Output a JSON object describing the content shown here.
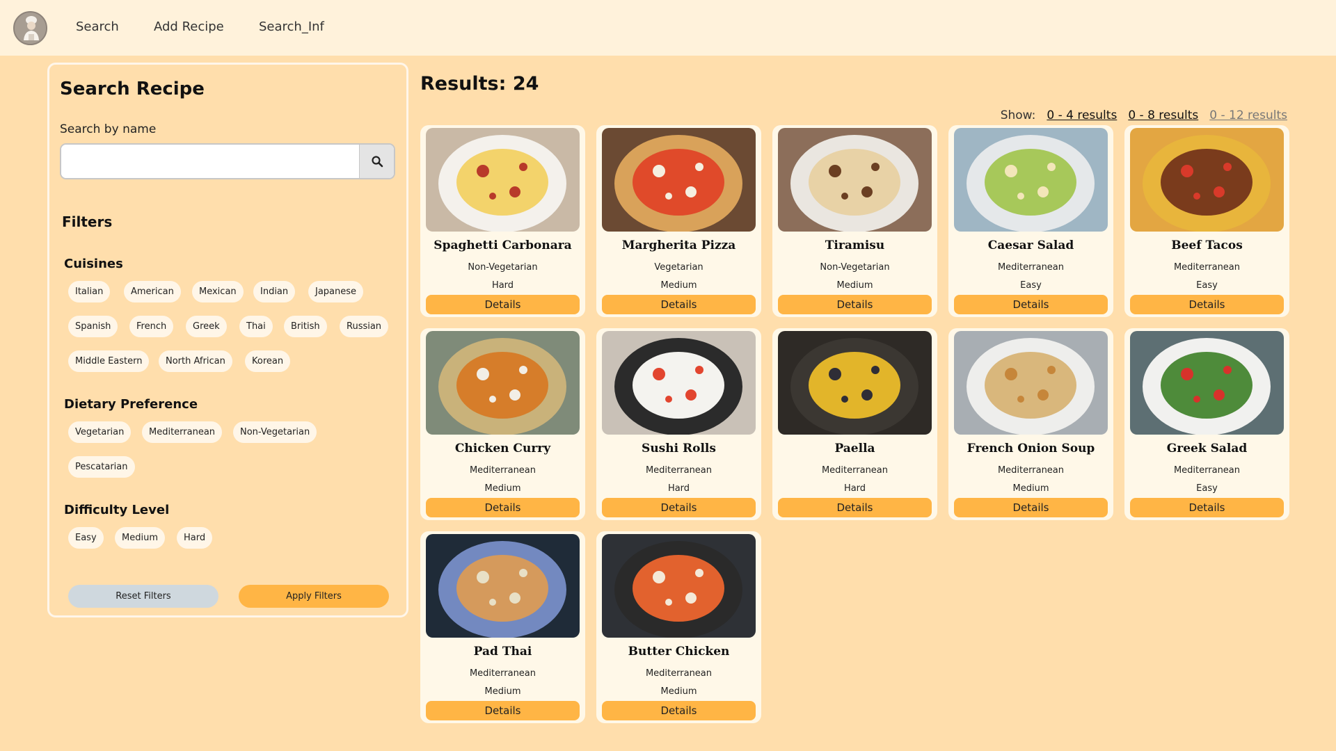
{
  "nav": {
    "logo_alt": "chef logo",
    "links": [
      "Search",
      "Add Recipe",
      "Search_Inf"
    ]
  },
  "sidebar": {
    "title": "Search Recipe",
    "search_label": "Search by name",
    "search_value": "",
    "filters_title": "Filters",
    "cuisines_title": "Cuisines",
    "cuisines": [
      "Italian",
      "American",
      "Mexican",
      "Indian",
      "Japanese",
      "Spanish",
      "French",
      "Greek",
      "Thai",
      "British",
      "Russian",
      "Middle Eastern",
      "North African",
      "Korean"
    ],
    "dietary_title": "Dietary Preference",
    "dietary": [
      "Vegetarian",
      "Mediterranean",
      "Non-Vegetarian",
      "Pescatarian"
    ],
    "difficulty_title": "Difficulty Level",
    "difficulty": [
      "Easy",
      "Medium",
      "Hard"
    ],
    "reset_label": "Reset Filters",
    "apply_label": "Apply Filters"
  },
  "results": {
    "title": "Results: 24",
    "show_label": "Show:",
    "show_options": [
      "0 - 4 results",
      "0 - 8 results",
      "0 - 12 results"
    ],
    "details_label": "Details",
    "recipes": [
      {
        "name": "Spaghetti Carbonara",
        "diet": "Non-Vegetarian",
        "difficulty": "Hard",
        "icon": "pasta-image"
      },
      {
        "name": "Margherita Pizza",
        "diet": "Vegetarian",
        "difficulty": "Medium",
        "icon": "pizza-image"
      },
      {
        "name": "Tiramisu",
        "diet": "Non-Vegetarian",
        "difficulty": "Medium",
        "icon": "tiramisu-image"
      },
      {
        "name": "Caesar Salad",
        "diet": "Mediterranean",
        "difficulty": "Easy",
        "icon": "salad-image"
      },
      {
        "name": "Beef Tacos",
        "diet": "Mediterranean",
        "difficulty": "Easy",
        "icon": "tacos-image"
      },
      {
        "name": "Chicken Curry",
        "diet": "Mediterranean",
        "difficulty": "Medium",
        "icon": "curry-image"
      },
      {
        "name": "Sushi Rolls",
        "diet": "Mediterranean",
        "difficulty": "Hard",
        "icon": "sushi-image"
      },
      {
        "name": "Paella",
        "diet": "Mediterranean",
        "difficulty": "Hard",
        "icon": "paella-image"
      },
      {
        "name": "French Onion Soup",
        "diet": "Mediterranean",
        "difficulty": "Medium",
        "icon": "soup-image"
      },
      {
        "name": "Greek Salad",
        "diet": "Mediterranean",
        "difficulty": "Easy",
        "icon": "greek-salad-image"
      },
      {
        "name": "Pad Thai",
        "diet": "Mediterranean",
        "difficulty": "Medium",
        "icon": "pad-thai-image"
      },
      {
        "name": "Butter Chicken",
        "diet": "Mediterranean",
        "difficulty": "Medium",
        "icon": "butter-chicken-image"
      }
    ]
  }
}
